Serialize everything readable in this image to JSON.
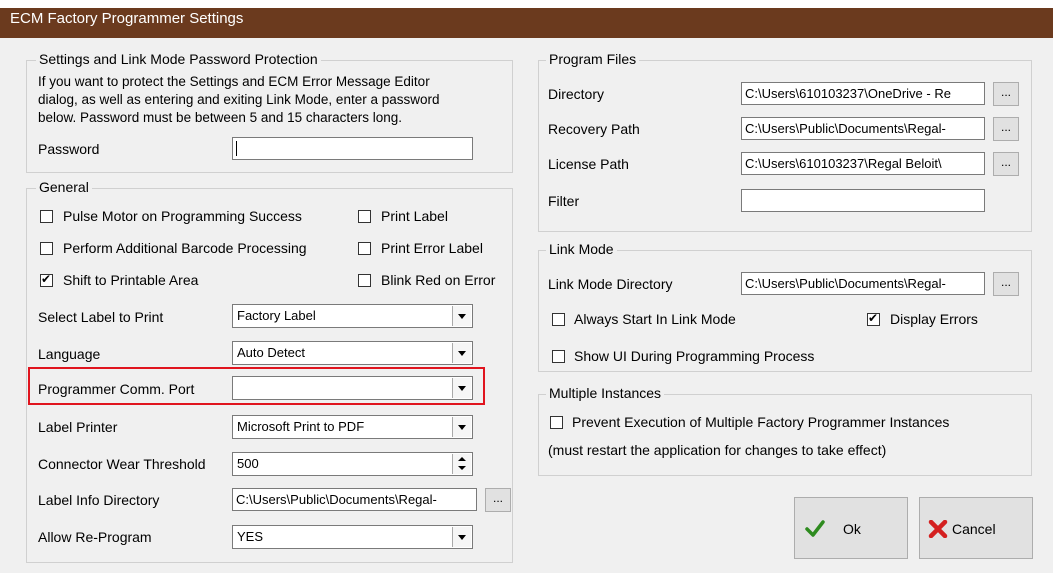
{
  "window": {
    "title": "ECM Factory Programmer Settings"
  },
  "password_group": {
    "title": "Settings and Link Mode Password Protection",
    "description_lines": [
      "If you want to protect the Settings and ECM Error Message Editor",
      "dialog, as well as entering and exiting Link Mode, enter a password",
      "below. Password must be between 5 and 15 characters long."
    ],
    "password_label": "Password",
    "password_value": ""
  },
  "general": {
    "title": "General",
    "checkboxes": {
      "pulse_motor": {
        "label": "Pulse Motor on Programming Success",
        "checked": false
      },
      "print_label": {
        "label": "Print Label",
        "checked": false
      },
      "barcode": {
        "label": "Perform Additional Barcode Processing",
        "checked": false
      },
      "print_error_label": {
        "label": "Print Error Label",
        "checked": false
      },
      "shift_printable": {
        "label": "Shift to Printable Area",
        "checked": true
      },
      "blink_red": {
        "label": "Blink Red on Error",
        "checked": false
      }
    },
    "fields": {
      "select_label": {
        "label": "Select Label to Print",
        "value": "Factory Label"
      },
      "language": {
        "label": "Language",
        "value": "Auto Detect"
      },
      "comm_port": {
        "label": "Programmer Comm. Port",
        "value": ""
      },
      "label_printer": {
        "label": "Label Printer",
        "value": "Microsoft Print to PDF"
      },
      "connector_wear": {
        "label": "Connector Wear Threshold",
        "value": "500"
      },
      "label_info_dir": {
        "label": "Label Info Directory",
        "value": "C:\\Users\\Public\\Documents\\Regal-"
      },
      "allow_reprogram": {
        "label": "Allow Re-Program",
        "value": "YES"
      }
    },
    "browse_label": "..."
  },
  "program_files": {
    "title": "Program Files",
    "directory": {
      "label": "Directory",
      "value": "C:\\Users\\610103237\\OneDrive - Re"
    },
    "recovery": {
      "label": "Recovery Path",
      "value": "C:\\Users\\Public\\Documents\\Regal-"
    },
    "license": {
      "label": "License Path",
      "value": "C:\\Users\\610103237\\Regal Beloit\\"
    },
    "filter": {
      "label": "Filter",
      "value": ""
    },
    "browse_label": "..."
  },
  "link_mode": {
    "title": "Link Mode",
    "directory": {
      "label": "Link Mode Directory",
      "value": "C:\\Users\\Public\\Documents\\Regal-"
    },
    "always_start": {
      "label": "Always Start In Link Mode",
      "checked": false
    },
    "display_errors": {
      "label": "Display Errors",
      "checked": true
    },
    "show_ui": {
      "label": "Show UI During Programming Process",
      "checked": false
    },
    "browse_label": "..."
  },
  "multiple_instances": {
    "title": "Multiple Instances",
    "prevent": {
      "label": "Prevent Execution of Multiple Factory Programmer Instances",
      "checked": false
    },
    "note": "(must restart the application for changes to take effect)"
  },
  "buttons": {
    "ok": "Ok",
    "cancel": "Cancel"
  },
  "colors": {
    "titlebar": "#6b3a1e",
    "highlight": "#e0141e",
    "ok_check": "#2e8b1f",
    "cancel_x": "#d42020"
  }
}
